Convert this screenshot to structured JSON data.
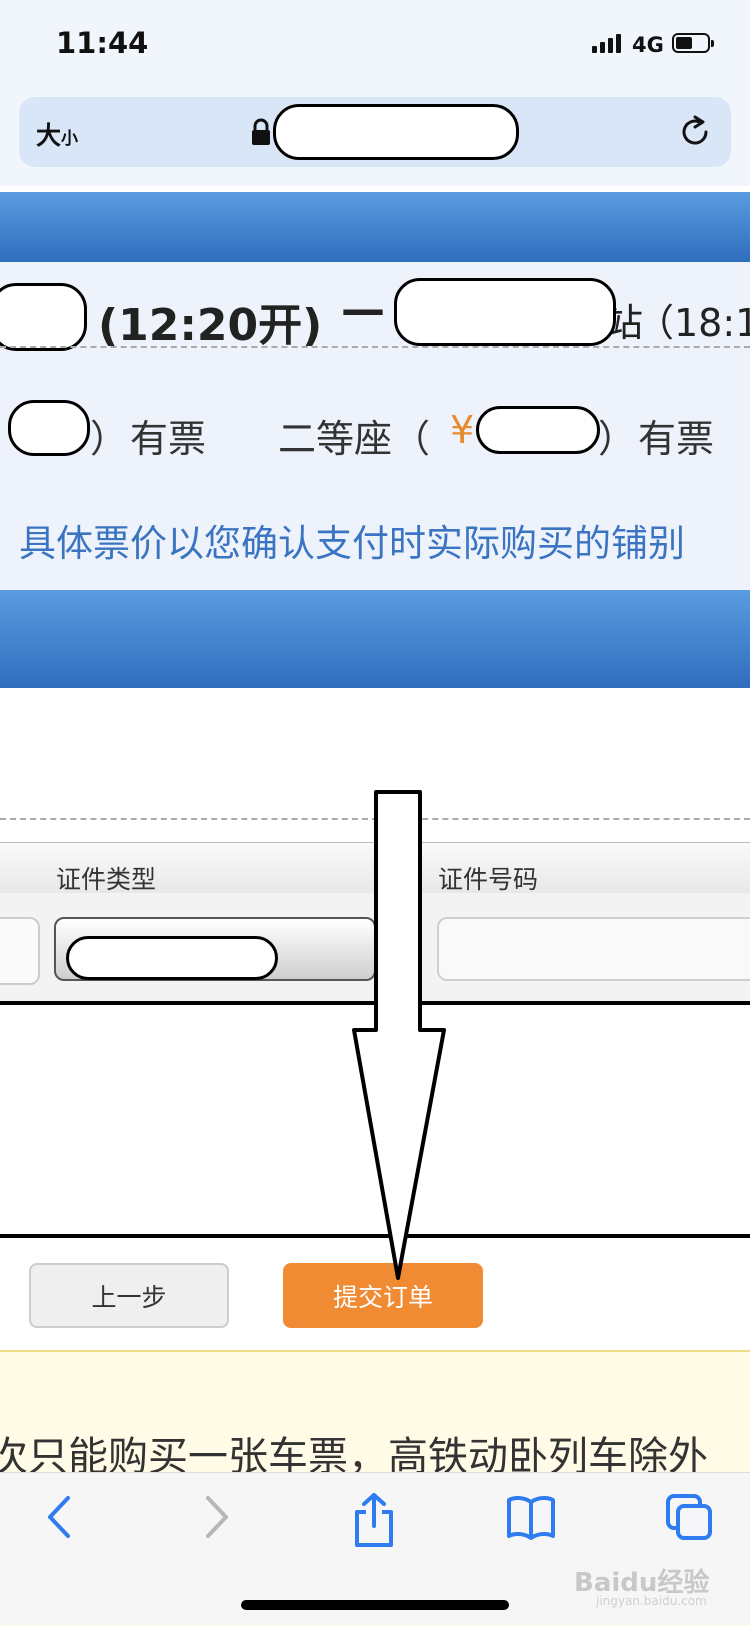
{
  "status_bar": {
    "time": "11:44",
    "network": "4G"
  },
  "browser": {
    "text_size_big": "大",
    "text_size_small": "小"
  },
  "train": {
    "depart_time": "(12:20开)",
    "dash": "—",
    "station_tail": "站",
    "arrive_time": "（18:1",
    "paren_close": "）",
    "availability": "有票",
    "seat2_label": "二等座（",
    "currency": "¥"
  },
  "price_note": "具体票价以您确认支付时实际购买的铺别",
  "passenger_table": {
    "col_id_type": "证件类型",
    "col_id_number": "证件号码"
  },
  "buttons": {
    "prev": "上一步",
    "submit": "提交订单"
  },
  "notice": "次只能购买一张车票，高铁动卧列车除外",
  "watermark": {
    "main": "Baidu经验",
    "sub": "jingyan.baidu.com"
  },
  "colors": {
    "accent_orange": "#f08a33",
    "link_blue": "#3a74c2",
    "header_blue": "#3f80cf"
  }
}
